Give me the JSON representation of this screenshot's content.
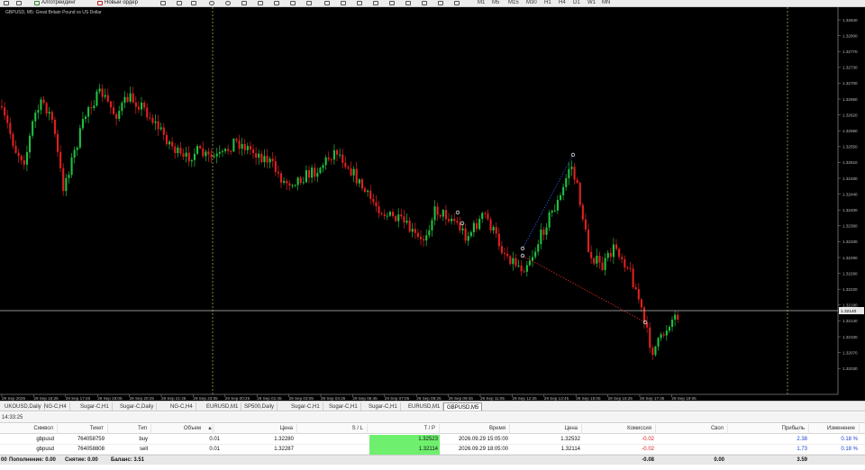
{
  "toolbar": {
    "algo_trading_label": "Алготрейдинг",
    "new_order_label": "Новый ордер",
    "timeframes": [
      "M1",
      "M5",
      "M15",
      "M30",
      "H1",
      "H4",
      "D1",
      "W1",
      "MN"
    ]
  },
  "chart": {
    "title": "GBPUSD, M5:  Great Britain Pound vs US Dollar",
    "current_price": "1.32140",
    "price_labels": [
      "1.32840",
      "1.32800",
      "1.32770",
      "1.32730",
      "1.32700",
      "1.32660",
      "1.32620",
      "1.32590",
      "1.32550",
      "1.32510",
      "1.32480",
      "1.32440",
      "1.32400",
      "1.32360",
      "1.32330",
      "1.32290",
      "1.32260",
      "1.32220",
      "1.32180",
      "1.32140",
      "1.32100",
      "1.32070",
      "1.32030"
    ],
    "time_labels": [
      "29 Sep 2026",
      "29 Sep 16:25",
      "29 Sep 17:45",
      "29 Sep 19:05",
      "29 Sep 20:25",
      "29 Sep 21:45",
      "29 Sep 23:05",
      "29 Sep 00:25",
      "29 Sep 01:45",
      "29 Sep 03:05",
      "29 Sep 04:25",
      "29 Sep 05:45",
      "29 Sep 07:05",
      "29 Sep 08:25",
      "29 Sep 09:45",
      "29 Sep 11:05",
      "29 Sep 12:25",
      "29 Sep 13:45",
      "29 Sep 15:05",
      "29 Sep 16:25",
      "29 Sep 17:45",
      "29 Sep 19:05"
    ],
    "colors": {
      "bull": "#20c040",
      "bear": "#e02020",
      "background": "#000000",
      "separator": "#b0a040"
    }
  },
  "symbol_tabs": [
    "UKOUSD,Daily",
    "NG-C,H4",
    "Sugar-C,H1",
    "Sugar-C,Daily",
    "NG-C,H4",
    "EURUSD,M1",
    "SP500,Daily",
    "Sugar-C,H1",
    "Sugar-C,H1",
    "Sugar-C,H1",
    "EURUSD,M1",
    "GBPUSD,M5"
  ],
  "active_tab_index": 11,
  "terminal": {
    "clock": "14:33:25",
    "headers": [
      "Символ",
      "Тикет",
      "Тип",
      "Объем",
      "Цена",
      "S / L",
      "T / P",
      "Время",
      "Цена",
      "Комиссия",
      "Своп",
      "Прибыль",
      "Изменение"
    ],
    "sort_arrow": "▲",
    "rows": [
      {
        "symbol": "gbpusd",
        "ticket": "764058759",
        "type": "buy",
        "volume": "0.01",
        "price": "1.32280",
        "sl": "",
        "tp": "1.32523",
        "time": "2026.09.29 15:05:00",
        "cur_price": "1.32532",
        "commission": "-0.02",
        "swap": "",
        "profit": "2.38",
        "change": "0.18 %"
      },
      {
        "symbol": "gbpusd",
        "ticket": "764058808",
        "type": "sell",
        "volume": "0.01",
        "price": "1.32287",
        "sl": "",
        "tp": "1.32114",
        "time": "2026.09.29 18:05:00",
        "cur_price": "1.32114",
        "commission": "-0.02",
        "swap": "",
        "profit": "1.73",
        "change": "0.18 %"
      }
    ],
    "balance": {
      "prefix": "00",
      "deposit": "Пополнение: 0.00",
      "withdraw": "Снятие: 0.00",
      "balance": "Баланс: 3.51",
      "commission_total": "-0.08",
      "swap_total": "0.00",
      "profit_total": "3.59"
    }
  }
}
